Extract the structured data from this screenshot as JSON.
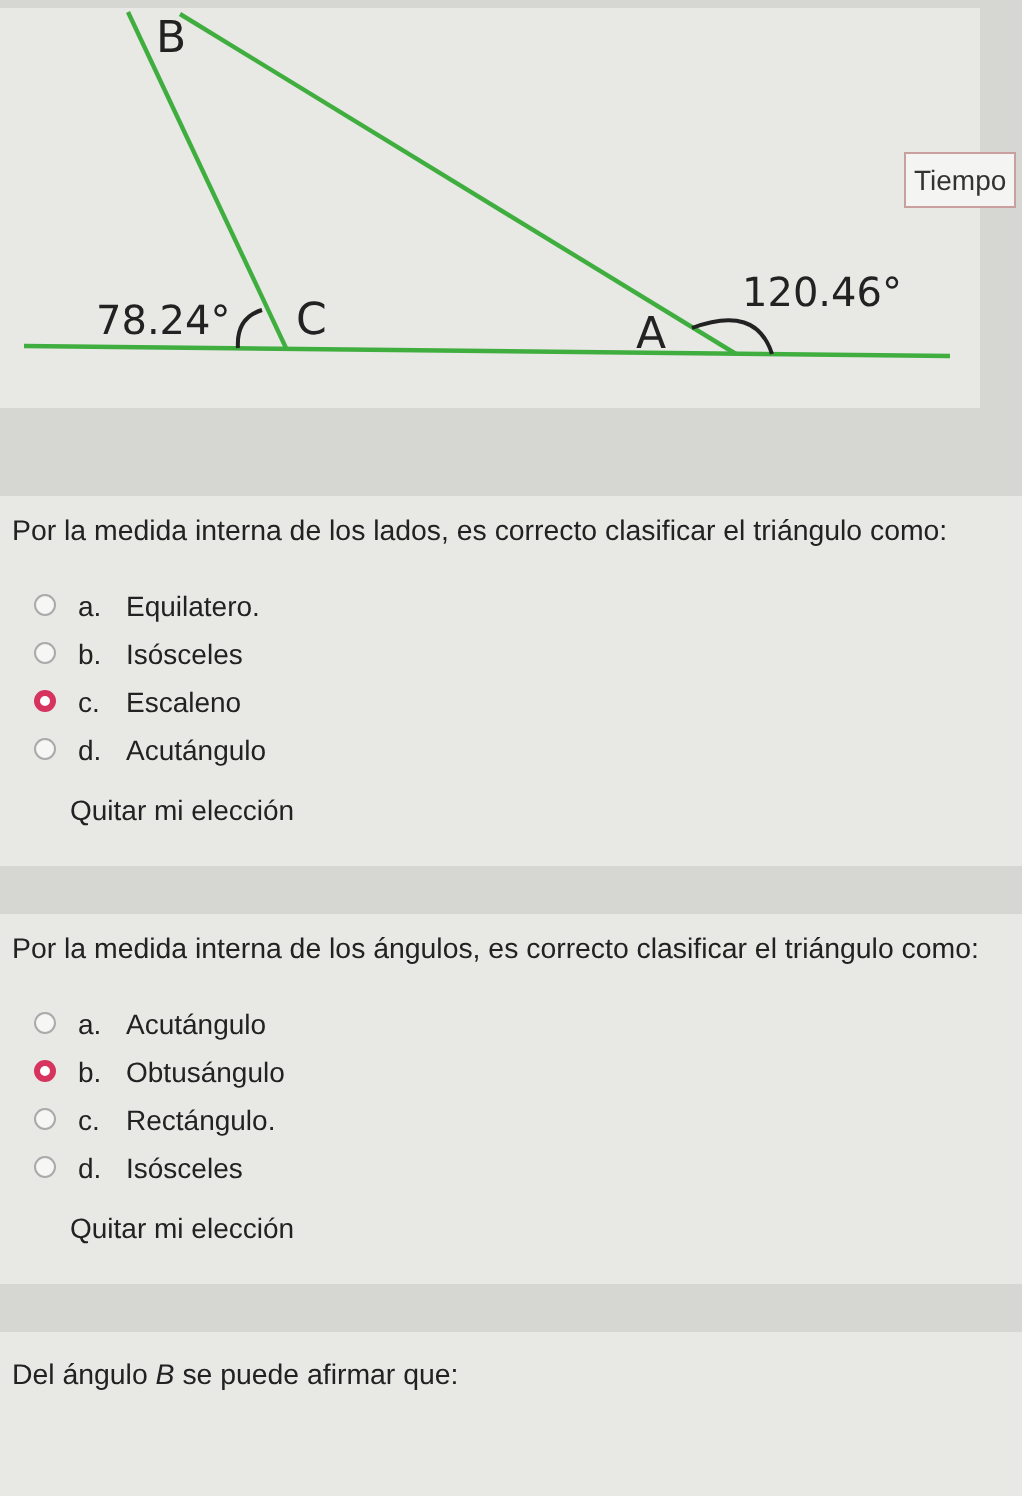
{
  "diagram": {
    "vertices": [
      {
        "label": "B"
      },
      {
        "label": "C"
      },
      {
        "label": "A"
      }
    ],
    "angles": [
      "78.24°",
      "120.46°"
    ],
    "timer": "Tiempo"
  },
  "questions": [
    {
      "prompt": "Por la medida interna de los lados, es correcto clasificar el triángulo como:",
      "options": [
        {
          "letter": "a.",
          "text": "Equilatero.",
          "selected": false
        },
        {
          "letter": "b.",
          "text": "Isósceles",
          "selected": false
        },
        {
          "letter": "c.",
          "text": "Escaleno",
          "selected": true
        },
        {
          "letter": "d.",
          "text": "Acutángulo",
          "selected": false
        }
      ],
      "clear": "Quitar mi elección"
    },
    {
      "prompt": "Por la medida interna de los ángulos, es correcto clasificar el triángulo como:",
      "options": [
        {
          "letter": "a.",
          "text": "Acutángulo",
          "selected": false
        },
        {
          "letter": "b.",
          "text": "Obtusángulo",
          "selected": true
        },
        {
          "letter": "c.",
          "text": "Rectángulo.",
          "selected": false
        },
        {
          "letter": "d.",
          "text": "Isósceles",
          "selected": false
        }
      ],
      "clear": "Quitar mi elección"
    },
    {
      "prompt": "Del ángulo *B* se puede afirmar que:"
    }
  ]
}
